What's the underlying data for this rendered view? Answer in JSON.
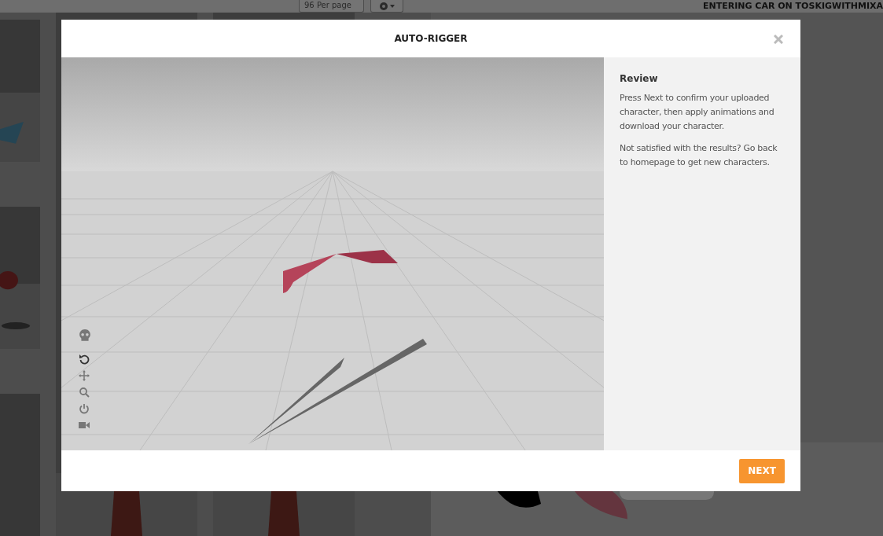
{
  "background": {
    "per_page": "96 Per page",
    "heading": "ENTERING CAR ON TOSKIGWITHMIXA"
  },
  "modal": {
    "title": "AUTO-RIGGER",
    "viewer": {
      "tools": [
        {
          "kind": "skeleton"
        },
        {
          "kind": "rotate"
        },
        {
          "kind": "move"
        },
        {
          "kind": "zoom"
        },
        {
          "kind": "power"
        },
        {
          "kind": "camera"
        }
      ]
    },
    "panel": {
      "heading": "Review",
      "paragraphs": [
        "Press Next to confirm your uploaded character, then apply animations and download your character.",
        "Not satisfied with the results? Go back to homepage to get new characters."
      ]
    },
    "buttons": [
      "NEXT"
    ]
  }
}
